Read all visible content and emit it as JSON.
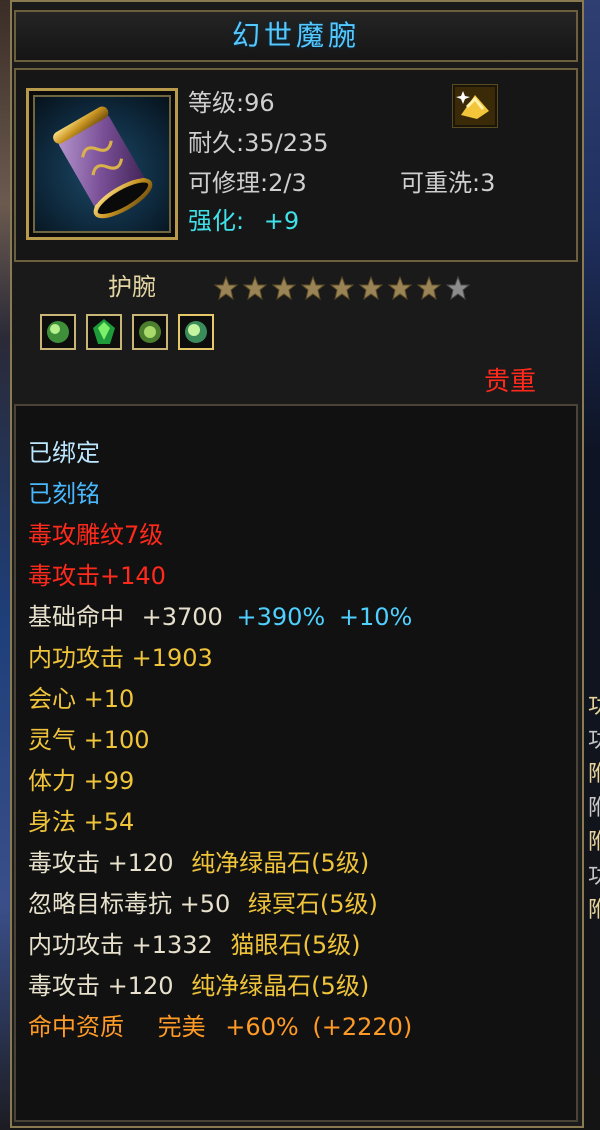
{
  "item": {
    "name": "幻世魔腕",
    "stats": {
      "level": "等级:96",
      "durability": "耐久:35/235",
      "repairable": "可修理:2/3",
      "rewashable": "可重洗:3",
      "enhance_label": "强化:",
      "enhance_value": "+9"
    },
    "slot": "护腕",
    "stars": {
      "filled": 8,
      "total": 9
    },
    "gems": [
      "green-crystal",
      "green-crystal",
      "green-crystal",
      "green-crystal"
    ],
    "precious_tag": "贵重"
  },
  "attributes": {
    "bound": "已绑定",
    "engraved": "已刻铭",
    "poison_carving": "毒攻雕纹7级",
    "poison_attack": "毒攻击+140",
    "hit_label": "基础命中",
    "hit_base": "+3700",
    "hit_pct1": "+390%",
    "hit_pct2": "+10%",
    "inner_attack": "内功攻击 +1903",
    "crit": "会心 +10",
    "spirit": "灵气 +100",
    "stamina": "体力 +99",
    "agility": "身法 +54",
    "gem1_stat": "毒攻击 +120",
    "gem1_name": "纯净绿晶石(5级)",
    "gem2_stat": "忽略目标毒抗 +50",
    "gem2_name": "绿冥石(5级)",
    "gem3_stat": "内功攻击 +1332",
    "gem3_name": "猫眼石(5级)",
    "gem4_stat": "毒攻击 +120",
    "gem4_name": "纯净绿晶石(5级)",
    "aptitude_label": "命中资质",
    "aptitude_grade": "完美",
    "aptitude_pct": "+60%",
    "aptitude_bonus": "(+2220)"
  },
  "background_glyphs": [
    "功",
    "功",
    "附",
    "附",
    "附",
    "功",
    "附"
  ],
  "colors": {
    "title": "#55c8ff",
    "frame": "#8a7a52",
    "enhance": "#3fe0e8",
    "red": "#ff2a1c",
    "cyan": "#4fd0ff",
    "yellow": "#f0c43a",
    "orange": "#ff9a26"
  }
}
